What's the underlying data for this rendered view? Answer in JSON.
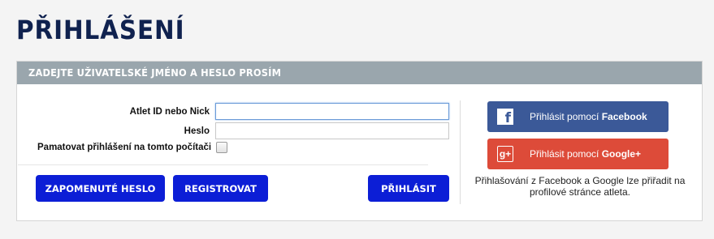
{
  "page": {
    "title": "PŘIHLÁŠENÍ"
  },
  "panel": {
    "header": "ZADEJTE UŽIVATELSKÉ JMÉNO A HESLO PROSÍM"
  },
  "form": {
    "username_label": "Atlet ID nebo Nick",
    "username_value": "",
    "password_label": "Heslo",
    "password_value": "",
    "remember_label": "Pamatovat přihlášení na tomto počítači",
    "remember_checked": false
  },
  "buttons": {
    "forgot": "ZAPOMENUTÉ HESLO",
    "register": "REGISTROVAT",
    "login": "PŘIHLÁSIT"
  },
  "social": {
    "facebook_prefix": "Přihlásit pomocí ",
    "facebook_brand": "Facebook",
    "google_prefix": "Přihlásit pomocí ",
    "google_brand": "Google+",
    "facebook_icon_glyph": "f",
    "google_icon_glyph": "g+",
    "note": "Přihlašování z Facebook a Google lze přiřadit na profilové stránce atleta."
  },
  "colors": {
    "title": "#10224f",
    "header_bg": "#9aa6ad",
    "primary_button": "#0c1ed6",
    "facebook": "#3b5998",
    "google": "#dd4b39"
  }
}
